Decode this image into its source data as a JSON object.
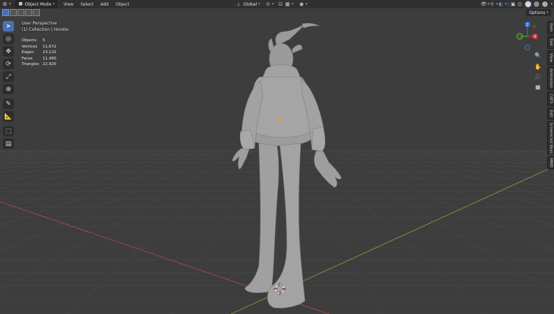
{
  "header": {
    "mode_label": "Object Mode",
    "menus": [
      "View",
      "Select",
      "Add",
      "Object"
    ],
    "transform_orientation": "Global",
    "options_label": "Options"
  },
  "overlay": {
    "perspective": "User Perspective",
    "collection": "(1) Collection | Hoodie",
    "stats": [
      {
        "label": "Objects",
        "value": "5"
      },
      {
        "label": "Vertices",
        "value": "11,672"
      },
      {
        "label": "Edges",
        "value": "23,132"
      },
      {
        "label": "Faces",
        "value": "11,460"
      },
      {
        "label": "Triangles",
        "value": "22,920"
      }
    ]
  },
  "toolbar": {
    "tools": [
      "select-box",
      "cursor",
      "move",
      "rotate",
      "scale",
      "transform",
      "annotate",
      "measure",
      "add-cube",
      "add-object"
    ]
  },
  "gizmo": {
    "axes": [
      {
        "label": "Z",
        "color": "#2f6fd6"
      },
      {
        "label": "X",
        "color": "#d23a3a"
      },
      {
        "label": "Y",
        "color": "#5a9e2f"
      }
    ]
  },
  "sidebar_tabs": [
    "Item",
    "Tool",
    "View",
    "Animation",
    "CATS",
    "Edit",
    "Screencast Keys",
    "MMD"
  ],
  "colors": {
    "background": "#3d3d3d",
    "grid": "#474747",
    "x_axis": "#b8474a",
    "y_axis": "#7aa03a",
    "active_tool": "#4772b3"
  }
}
